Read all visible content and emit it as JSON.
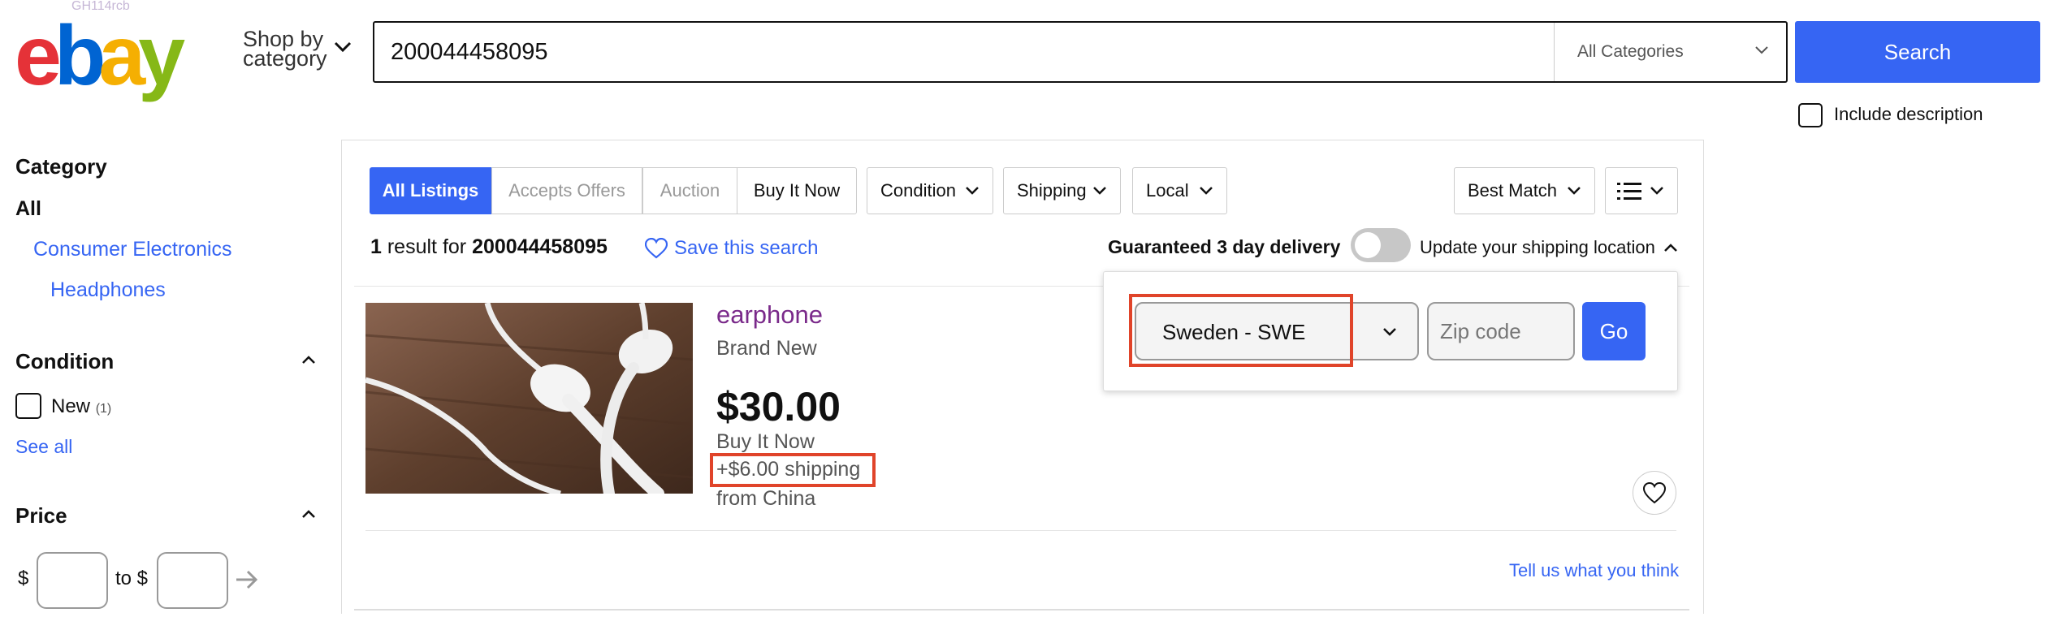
{
  "header": {
    "logo_tag": "GH114rcb",
    "logo_letters": [
      "e",
      "b",
      "a",
      "y"
    ],
    "logo_colors": [
      "#e53238",
      "#0064d2",
      "#f5af02",
      "#86b817"
    ],
    "shop_by_line1": "Shop by",
    "shop_by_line2": "category",
    "search_value": "200044458095",
    "category_select": "All Categories",
    "search_button": "Search",
    "include_description": "Include description"
  },
  "sidebar": {
    "category_heading": "Category",
    "all_label": "All",
    "category_link": "Consumer Electronics",
    "subcategory_link": "Headphones",
    "condition_heading": "Condition",
    "condition_option": "New",
    "condition_count": "(1)",
    "see_all": "See all",
    "price_heading": "Price",
    "price_dollar": "$",
    "price_to": "to $"
  },
  "toolbar": {
    "tabs": [
      "All Listings",
      "Accepts Offers",
      "Auction",
      "Buy It Now"
    ],
    "filters": [
      "Condition",
      "Shipping",
      "Local"
    ],
    "sort": "Best Match"
  },
  "results": {
    "count": "1",
    "result_for": "result for",
    "query": "200044458095",
    "save_search": "Save this search",
    "guaranteed": "Guaranteed 3 day delivery",
    "update_shipping": "Update your shipping location"
  },
  "shipping_popup": {
    "country": "Sweden - SWE",
    "zip_placeholder": "Zip code",
    "go": "Go"
  },
  "item": {
    "title": "earphone",
    "condition": "Brand New",
    "price": "$30.00",
    "format": "Buy It Now",
    "shipping": "+$6.00 shipping",
    "location": "from China"
  },
  "footer": {
    "feedback": "Tell us what you think"
  },
  "colors": {
    "accent": "#3665f3",
    "highlight": "#e0442a",
    "title_link": "#7a2a8a"
  }
}
